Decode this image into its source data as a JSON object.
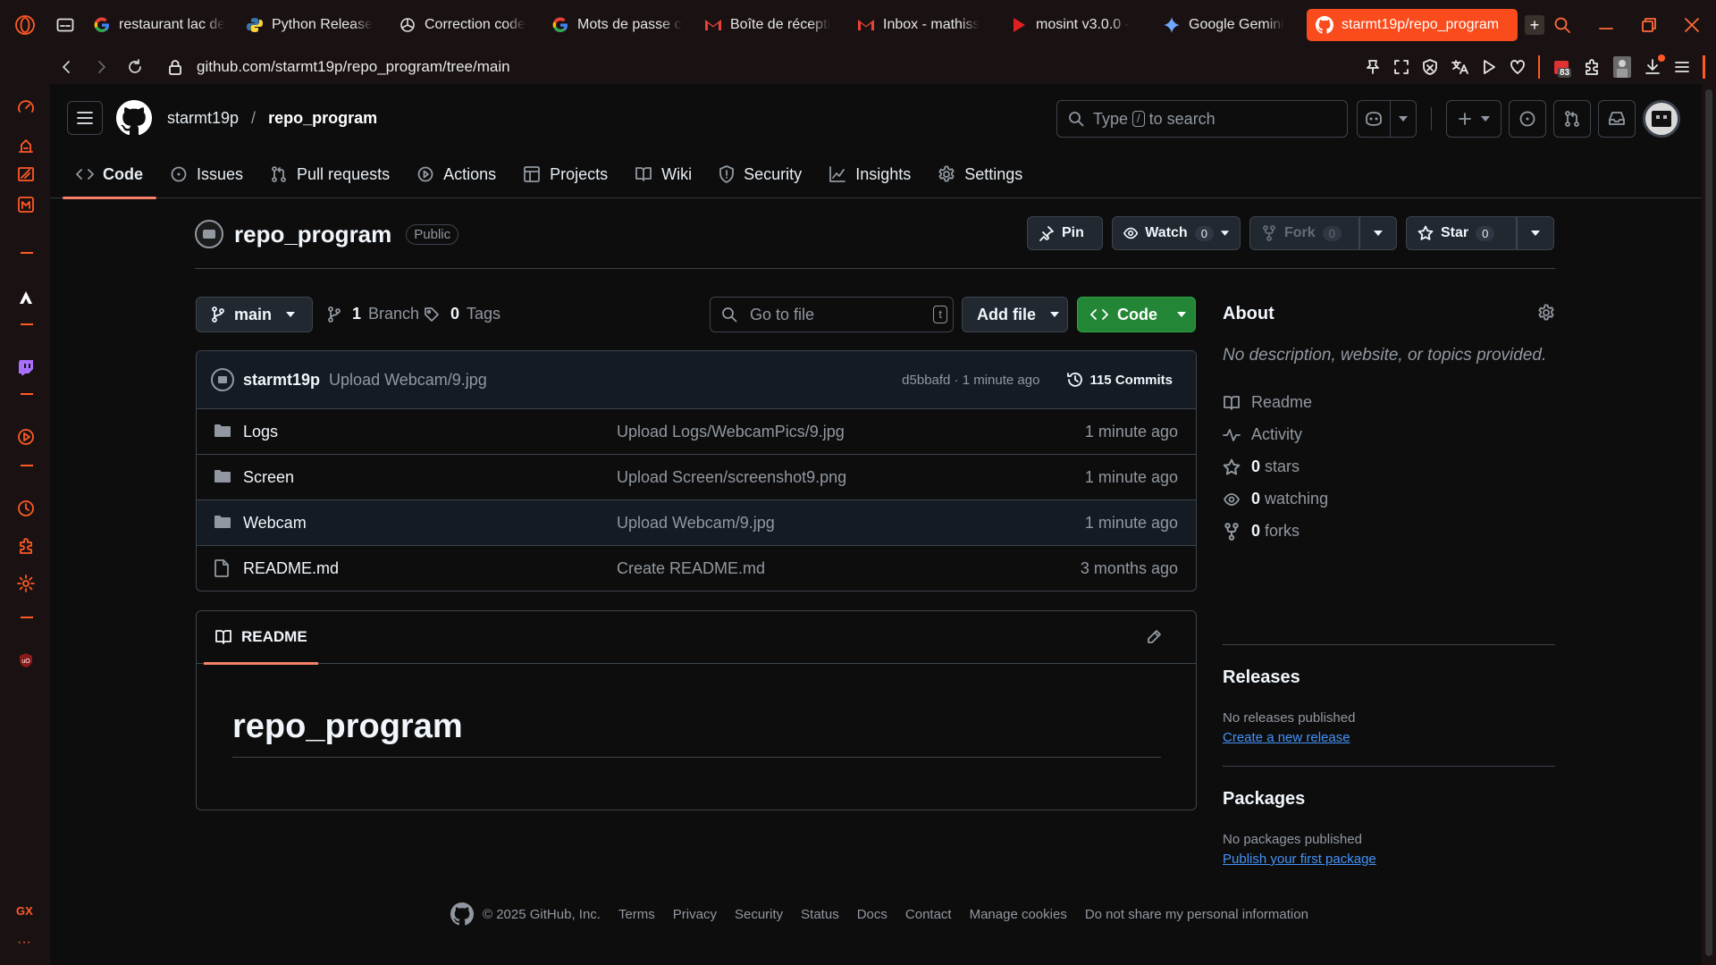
{
  "browser": {
    "tabs": [
      {
        "label": "restaurant lac de",
        "icon": "google-icon"
      },
      {
        "label": "Python Release",
        "icon": "python-icon"
      },
      {
        "label": "Correction code",
        "icon": "chatgpt-icon"
      },
      {
        "label": "Mots de passe c",
        "icon": "google-icon"
      },
      {
        "label": "Boîte de récepti",
        "icon": "gmail-icon"
      },
      {
        "label": "Inbox - mathiss",
        "icon": "gmail-icon"
      },
      {
        "label": "mosint v3.0.0 -",
        "icon": "youtube-icon"
      },
      {
        "label": "Google Gemini",
        "icon": "gemini-icon"
      },
      {
        "label": "starmt19p/repo_program",
        "icon": "github-icon",
        "active": true
      }
    ],
    "url_host": "github.com",
    "url_path": "/starmt19p/repo_program/tree/main",
    "ext_badge": "83",
    "accent": "#fa4b1c"
  },
  "sidebar": {
    "bottom_label": "GX",
    "more": "···"
  },
  "header": {
    "owner": "starmt19p",
    "slash": "/",
    "repo": "repo_program",
    "search_prefix": "Type",
    "search_key": "/",
    "search_suffix": "to search"
  },
  "repo_nav": [
    {
      "label": "Code",
      "icon": "code-icon",
      "selected": true
    },
    {
      "label": "Issues",
      "icon": "issue-icon"
    },
    {
      "label": "Pull requests",
      "icon": "pull-request-icon"
    },
    {
      "label": "Actions",
      "icon": "play-icon"
    },
    {
      "label": "Projects",
      "icon": "table-icon"
    },
    {
      "label": "Wiki",
      "icon": "book-icon"
    },
    {
      "label": "Security",
      "icon": "shield-icon"
    },
    {
      "label": "Insights",
      "icon": "graph-icon"
    },
    {
      "label": "Settings",
      "icon": "gear-icon"
    }
  ],
  "repo": {
    "name": "repo_program",
    "visibility": "Public",
    "pin_label": "Pin",
    "watch_label": "Watch",
    "watch_count": "0",
    "fork_label": "Fork",
    "fork_count": "0",
    "star_label": "Star",
    "star_count": "0"
  },
  "toolbar": {
    "branch": "main",
    "branch_count": "1",
    "branch_label": "Branch",
    "tag_count": "0",
    "tag_label": "Tags",
    "goto_placeholder": "Go to file",
    "goto_key": "t",
    "add_file": "Add file",
    "code": "Code"
  },
  "latest_commit": {
    "author": "starmt19p",
    "message": "Upload Webcam/9.jpg",
    "hash_time": "d5bbafd · 1 minute ago",
    "commits": "115 Commits"
  },
  "files": [
    {
      "name": "Logs",
      "type": "folder",
      "message": "Upload Logs/WebcamPics/9.jpg",
      "age": "1 minute ago"
    },
    {
      "name": "Screen",
      "type": "folder",
      "message": "Upload Screen/screenshot9.png",
      "age": "1 minute ago"
    },
    {
      "name": "Webcam",
      "type": "folder",
      "message": "Upload Webcam/9.jpg",
      "age": "1 minute ago"
    },
    {
      "name": "README.md",
      "type": "file",
      "message": "Create README.md",
      "age": "3 months ago"
    }
  ],
  "readme": {
    "tab": "README",
    "heading": "repo_program"
  },
  "about": {
    "title": "About",
    "description": "No description, website, or topics provided.",
    "items": [
      {
        "icon": "book-icon",
        "value": "",
        "label": "Readme"
      },
      {
        "icon": "pulse-icon",
        "value": "",
        "label": "Activity"
      },
      {
        "icon": "star-icon",
        "value": "0",
        "label": "stars"
      },
      {
        "icon": "eye-icon",
        "value": "0",
        "label": "watching"
      },
      {
        "icon": "fork-icon",
        "value": "0",
        "label": "forks"
      }
    ]
  },
  "releases": {
    "title": "Releases",
    "text": "No releases published",
    "link": "Create a new release"
  },
  "packages": {
    "title": "Packages",
    "text": "No packages published",
    "link": "Publish your first package"
  },
  "footer": {
    "copyright": "© 2025 GitHub, Inc.",
    "links": [
      "Terms",
      "Privacy",
      "Security",
      "Status",
      "Docs",
      "Contact",
      "Manage cookies",
      "Do not share my personal information"
    ]
  }
}
